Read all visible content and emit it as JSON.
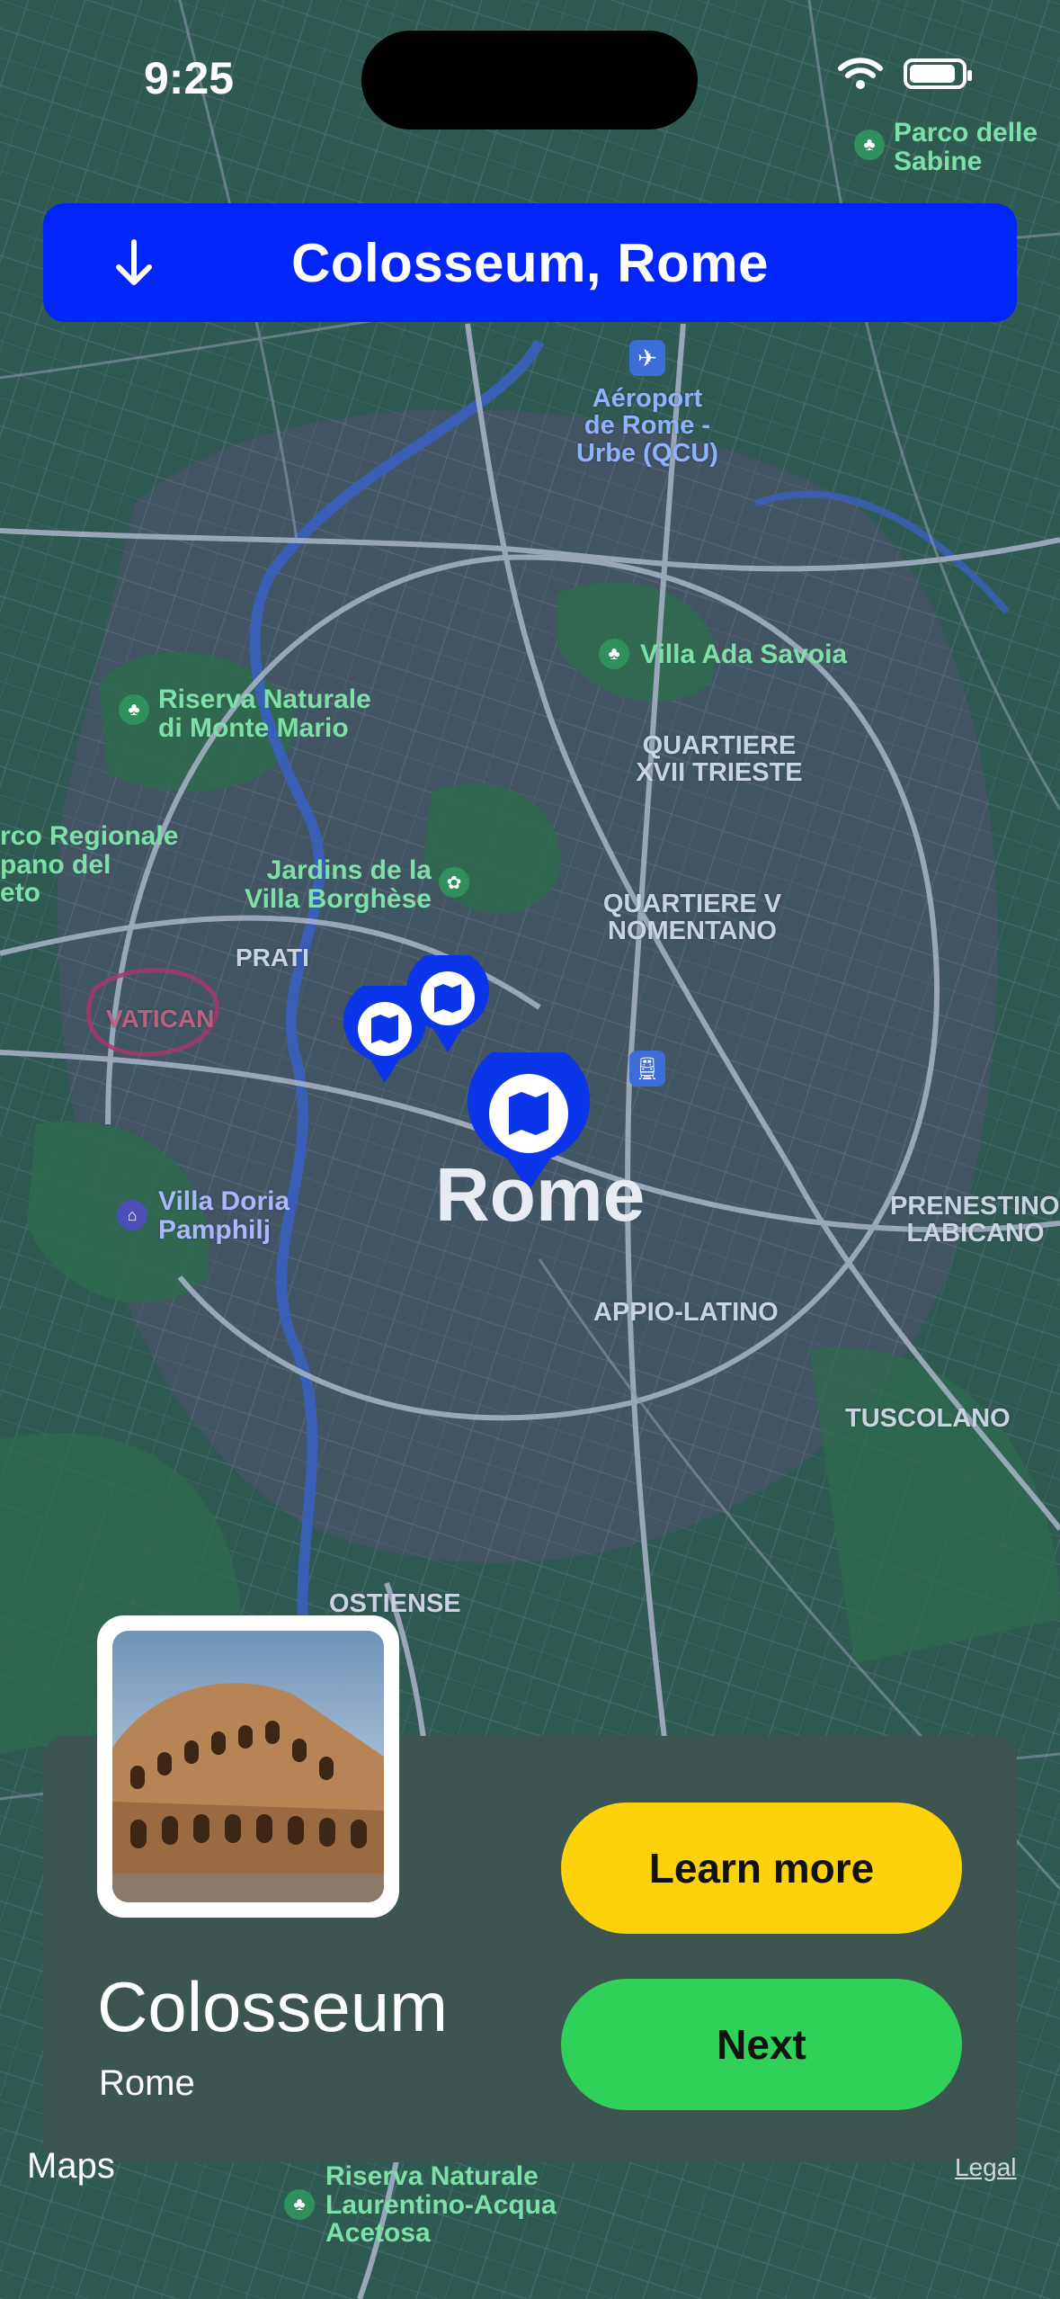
{
  "status": {
    "time": "9:25",
    "battery_level": 0.9
  },
  "header": {
    "title": "Colosseum, Rome",
    "arrow_icon": "arrow-down-icon"
  },
  "map": {
    "city_label": "Rome",
    "labels": {
      "parco_delle_sabine": "Parco delle\nSabine",
      "aeroport": "Aéroport\nde Rome -\nUrbe (QCU)",
      "villa_ada": "Villa Ada Savoia",
      "riserva_monte_mario": "Riserva Naturale\ndi Monte Mario",
      "trieste": "QUARTIERE\nXVII TRIESTE",
      "parco_regionale": "rco Regionale\npano del\neto",
      "jardins": "Jardins de la\nVilla Borghèse",
      "nomentano": "QUARTIERE V\nNOMENTANO",
      "prati": "PRATI",
      "vatican": "VATICAN",
      "villa_doria": "Villa Doria\nPamphilj",
      "prenestino": "PRENESTINO-\nLABICANO",
      "appio": "APPIO-LATINO",
      "tuscolano": "TUSCOLANO",
      "ostiense": "OSTIENSE",
      "riserva_laurentino": "Riserva Naturale\nLaurentino-Acqua\nAcetosa"
    }
  },
  "card": {
    "name": "Colosseum",
    "city": "Rome",
    "learn_more_label": "Learn more",
    "next_label": "Next"
  },
  "footer": {
    "maps_logo": "Maps",
    "legal": "Legal"
  },
  "colors": {
    "accent_blue": "#0226fa",
    "yellow": "#fdd20a",
    "green": "#2fd159",
    "card_bg": "#3c5550"
  }
}
